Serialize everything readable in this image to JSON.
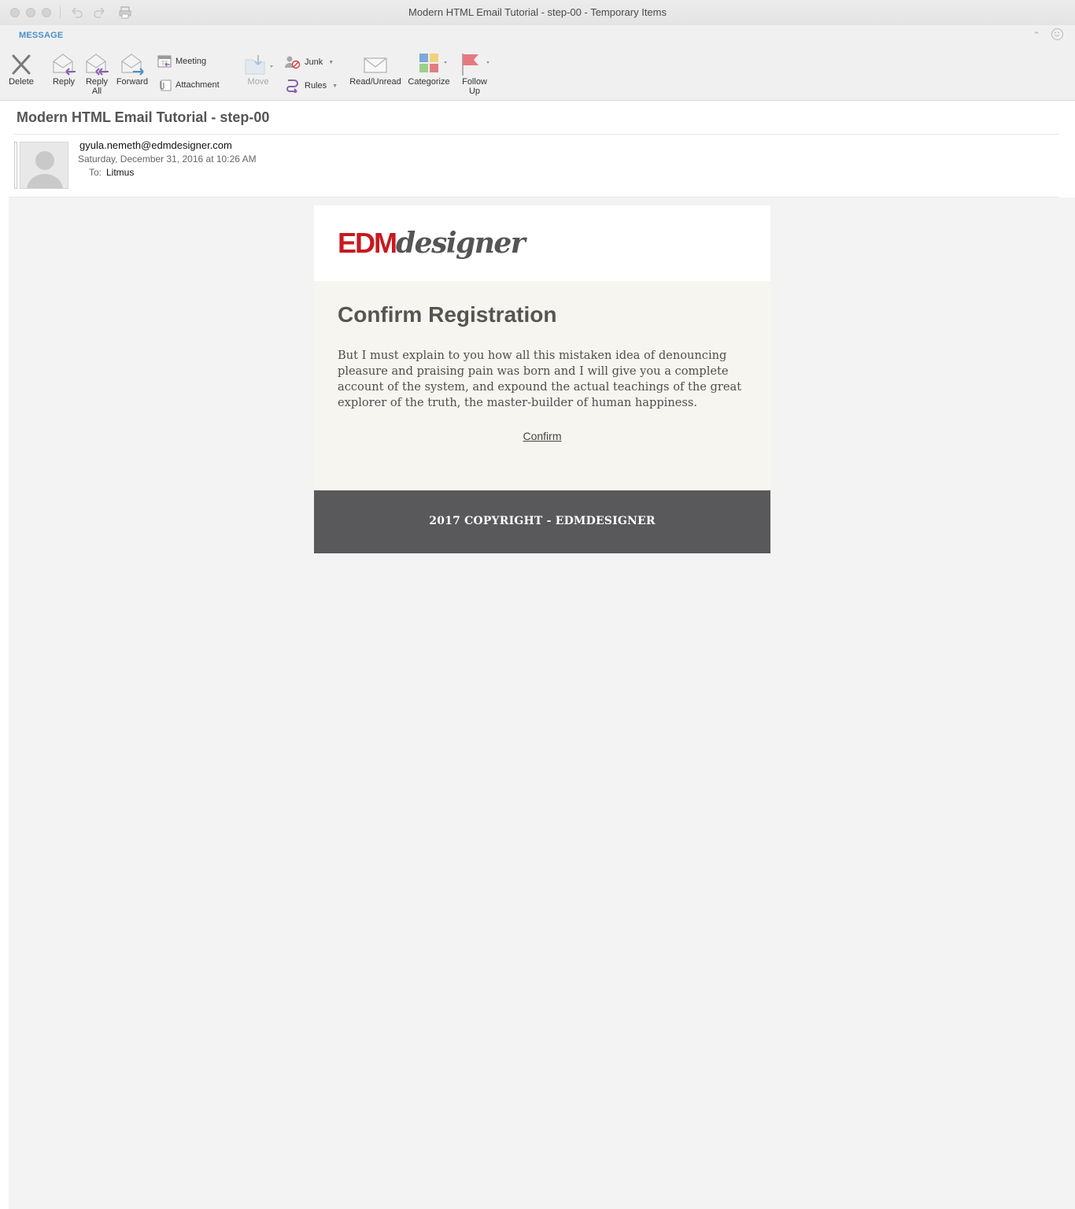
{
  "window": {
    "title": "Modern HTML Email Tutorial - step-00 - Temporary Items"
  },
  "ribbon": {
    "tab": "MESSAGE",
    "buttons": {
      "delete": "Delete",
      "reply": "Reply",
      "reply_all_line1": "Reply",
      "reply_all_line2": "All",
      "forward": "Forward",
      "meeting": "Meeting",
      "attachment": "Attachment",
      "move": "Move",
      "junk": "Junk",
      "rules": "Rules",
      "read_unread": "Read/Unread",
      "categorize": "Categorize",
      "follow_up_line1": "Follow",
      "follow_up_line2": "Up"
    },
    "icons": {
      "delete": "x-icon",
      "reply": "reply-icon",
      "reply_all": "reply-all-icon",
      "forward": "forward-icon",
      "meeting": "calendar-icon",
      "attachment": "paperclip-icon",
      "move": "move-folder-icon",
      "junk": "junk-icon",
      "rules": "rules-icon",
      "read_unread": "envelope-icon",
      "categorize": "category-grid-icon",
      "follow_up": "flag-icon"
    }
  },
  "message": {
    "subject": "Modern HTML Email Tutorial - step-00",
    "sender": "gyula.nemeth@edmdesigner.com",
    "date": "Saturday, December 31, 2016 at 10:26 AM",
    "to_label": "To:",
    "to": "Litmus"
  },
  "email": {
    "logo_part1": "EDM",
    "logo_part2": "designer",
    "heading": "Confirm Registration",
    "body": "But I must explain to you how all this mistaken idea of denouncing pleasure and praising pain was born and I will give you a complete account of the system, and expound the actual teachings of the great explorer of the truth, the master-builder of human happiness.",
    "confirm_link": "Confirm",
    "footer": "2017 COPYRIGHT - EDMDESIGNER"
  },
  "colors": {
    "accent": "#4a90c8",
    "logo_red": "#c8191f",
    "footer_bg": "#59585a",
    "content_bg": "#f7f5ef",
    "canvas_bg": "#f3f3f3"
  }
}
